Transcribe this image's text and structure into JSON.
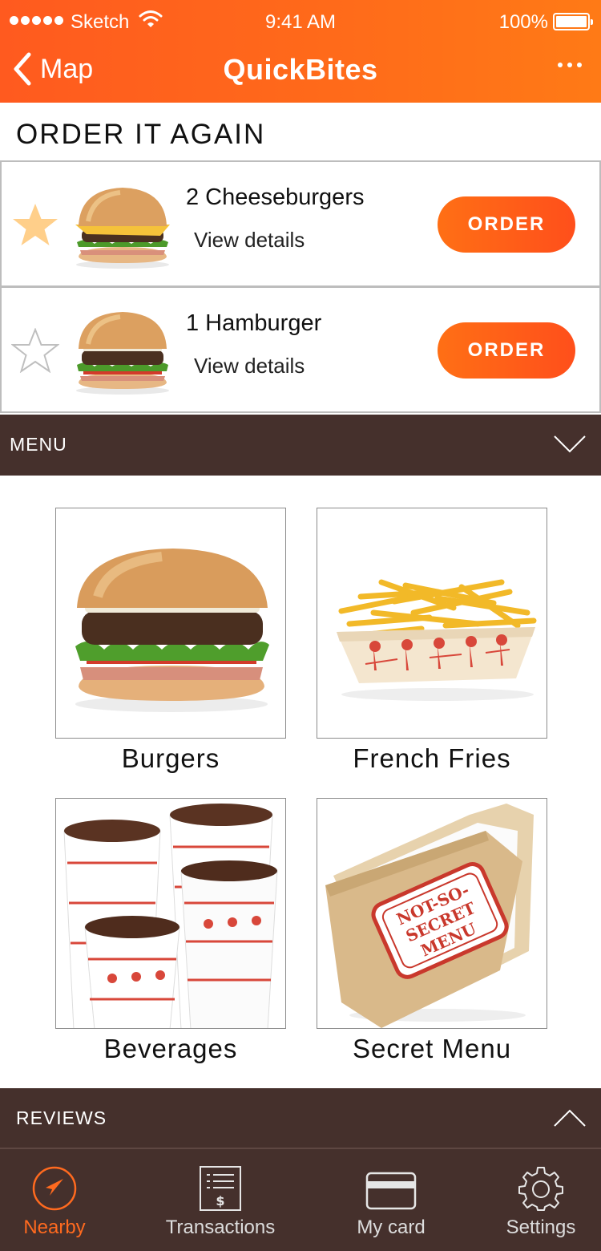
{
  "status_bar": {
    "carrier": "Sketch",
    "time": "9:41 AM",
    "battery": "100%"
  },
  "nav": {
    "back_label": "Map",
    "title": "QuickBites"
  },
  "order_again": {
    "title": "ORDER IT AGAIN",
    "items": [
      {
        "name": "2 Cheeseburgers",
        "details_link": "View details",
        "button": "ORDER",
        "favorite": true,
        "image": "cheeseburger"
      },
      {
        "name": "1 Hamburger",
        "details_link": "View details",
        "button": "ORDER",
        "favorite": false,
        "image": "hamburger"
      }
    ]
  },
  "menu": {
    "title": "MENU",
    "categories": [
      {
        "label": "Burgers",
        "image": "burger"
      },
      {
        "label": "French Fries",
        "image": "fries"
      },
      {
        "label": "Beverages",
        "image": "drinks"
      },
      {
        "label": "Secret Menu",
        "image": "folder",
        "image_text": [
          "NOT-SO-",
          "SECRET",
          "MENU"
        ]
      }
    ]
  },
  "reviews": {
    "title": "REVIEWS"
  },
  "tabs": [
    {
      "label": "Nearby",
      "icon": "location-arrow-icon",
      "active": true
    },
    {
      "label": "Transactions",
      "icon": "receipt-icon",
      "active": false
    },
    {
      "label": "My card",
      "icon": "card-icon",
      "active": false
    },
    {
      "label": "Settings",
      "icon": "gear-icon",
      "active": false
    }
  ],
  "colors": {
    "accent": "#ff5a1f",
    "bar_background": "#45302c",
    "favorite_star": "#ffcf8a"
  }
}
